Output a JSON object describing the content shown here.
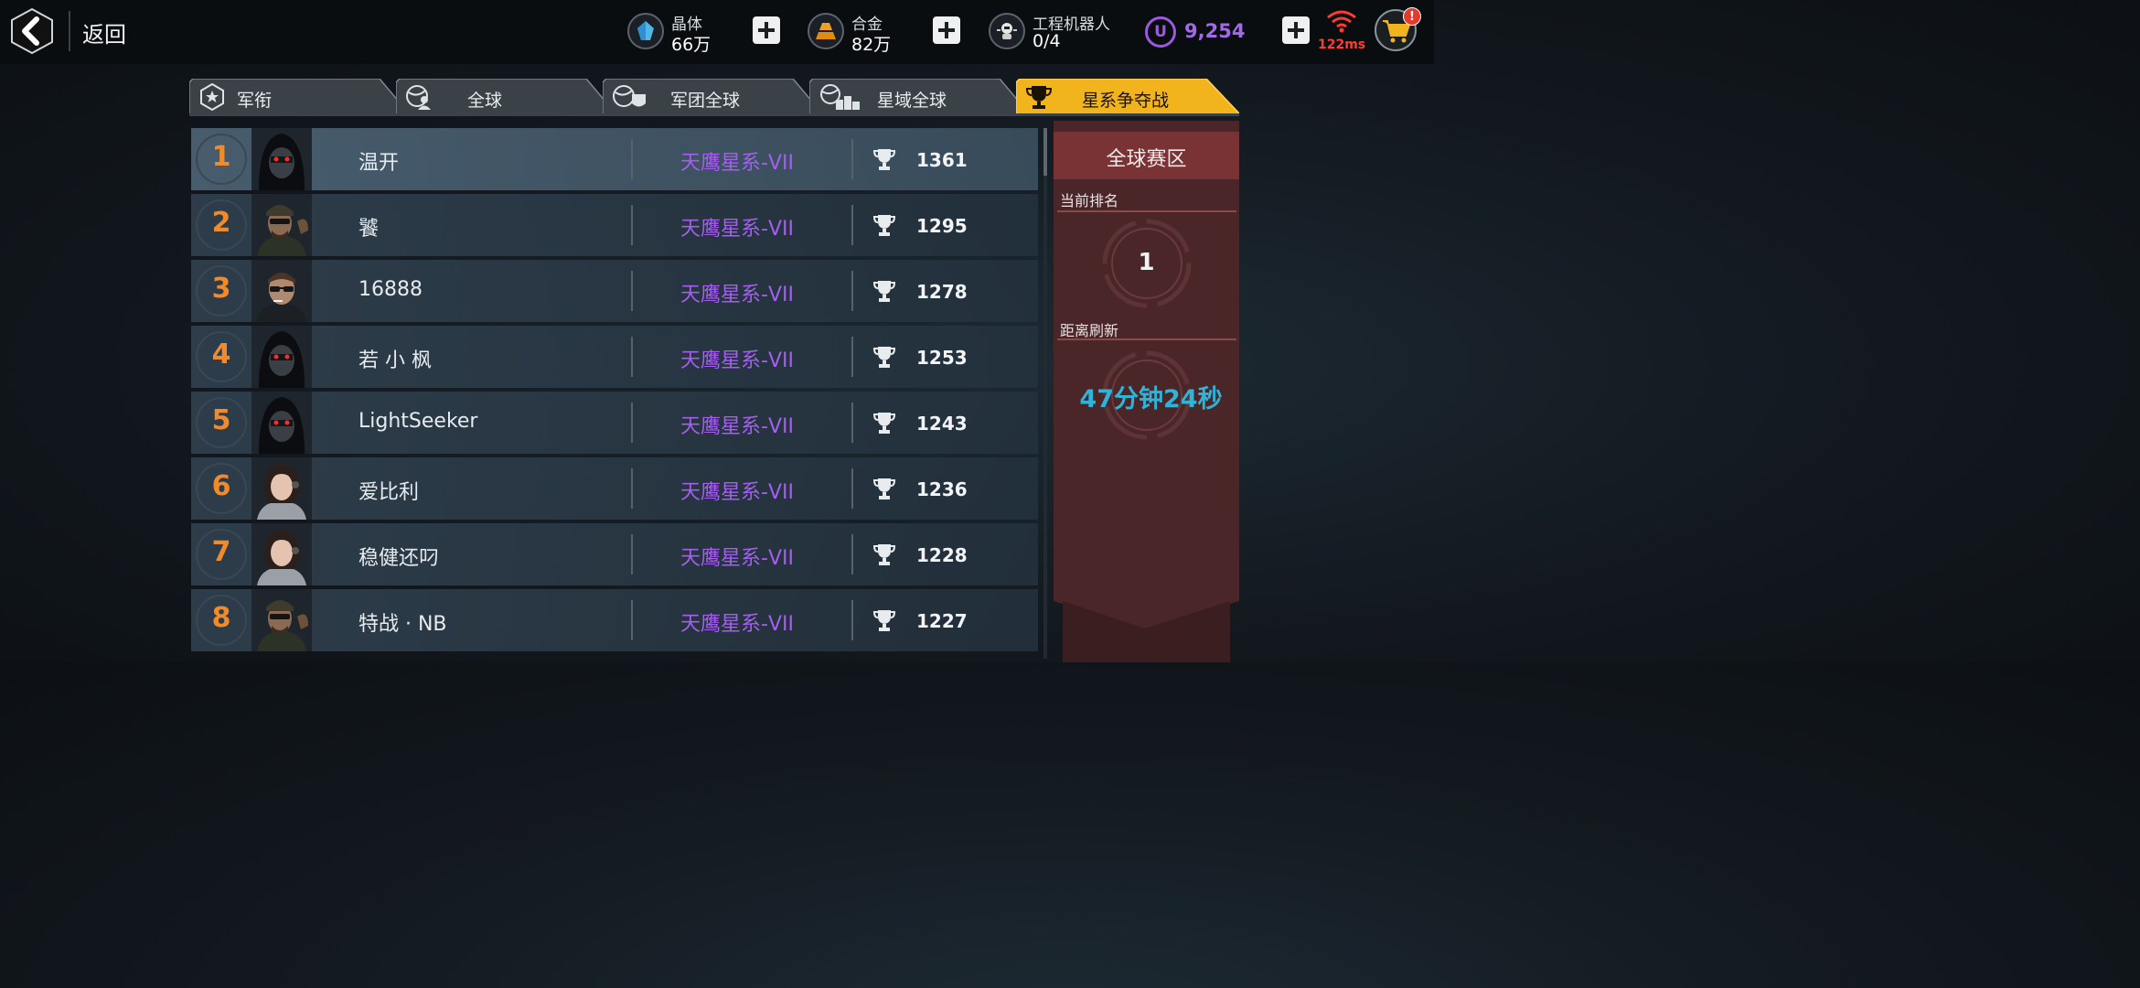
{
  "header": {
    "back_label": "返回",
    "resources": [
      {
        "name": "晶体",
        "value": "66万",
        "icon": "crystal-icon"
      },
      {
        "name": "合金",
        "value": "82万",
        "icon": "alloy-icon"
      },
      {
        "name": "工程机器人",
        "value": "0/4",
        "icon": "robot-icon"
      }
    ],
    "currency": {
      "symbol": "U",
      "value": "9,254"
    },
    "ping": "122ms",
    "cart_badge": "!"
  },
  "tabs": [
    {
      "label": "军衔",
      "icon": "rank-badge-icon",
      "active": false
    },
    {
      "label": "全球",
      "icon": "globe-player-icon",
      "active": false
    },
    {
      "label": "军团全球",
      "icon": "globe-shield-icon",
      "active": false
    },
    {
      "label": "星域全球",
      "icon": "globe-podium-icon",
      "active": false
    },
    {
      "label": "星系争夺战",
      "icon": "trophy-icon",
      "active": true
    }
  ],
  "leaderboard": [
    {
      "rank": "1",
      "name": "温开",
      "galaxy": "天鹰星系-VII",
      "score": "1361",
      "avatar": "hooded-avatar"
    },
    {
      "rank": "2",
      "name": "饕",
      "galaxy": "天鹰星系-VII",
      "score": "1295",
      "avatar": "soldier-avatar"
    },
    {
      "rank": "3",
      "name": "16888",
      "galaxy": "天鹰星系-VII",
      "score": "1278",
      "avatar": "sunglasses-avatar"
    },
    {
      "rank": "4",
      "name": "若 小 枫",
      "galaxy": "天鹰星系-VII",
      "score": "1253",
      "avatar": "hooded-avatar"
    },
    {
      "rank": "5",
      "name": "LightSeeker",
      "galaxy": "天鹰星系-VII",
      "score": "1243",
      "avatar": "hooded-avatar"
    },
    {
      "rank": "6",
      "name": "爱比利",
      "galaxy": "天鹰星系-VII",
      "score": "1236",
      "avatar": "female-avatar"
    },
    {
      "rank": "7",
      "name": "稳健还叼",
      "galaxy": "天鹰星系-VII",
      "score": "1228",
      "avatar": "female-avatar"
    },
    {
      "rank": "8",
      "name": "特战 · NB",
      "galaxy": "天鹰星系-VII",
      "score": "1227",
      "avatar": "soldier-avatar"
    }
  ],
  "panel": {
    "title": "全球赛区",
    "current_rank_label": "当前排名",
    "current_rank": "1",
    "refresh_label": "距离刷新",
    "refresh_time": "47分钟24秒"
  },
  "colors": {
    "rank_number": "#f08a2a",
    "galaxy_text": "#a55ef0",
    "active_tab": "#f2b41c",
    "panel_red": "#7a3335",
    "refresh_text": "#2fb3d9"
  }
}
